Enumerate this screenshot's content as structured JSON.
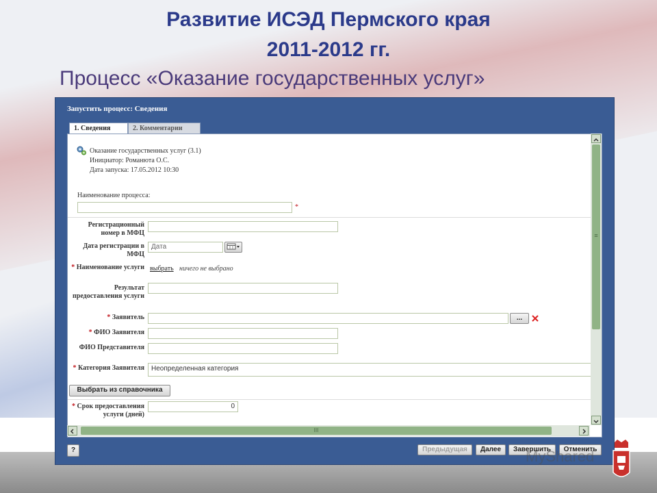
{
  "slide": {
    "title_line1": "Развитие ИСЭД Пермского края",
    "title_line2": "2011-2012 гг.",
    "title_line3": "Процесс «Оказание государственных услуг»"
  },
  "window": {
    "title": "Запустить процесс: Сведения",
    "tabs": [
      {
        "label": "1. Сведения",
        "active": true
      },
      {
        "label": "2. Комментарии",
        "active": false
      }
    ]
  },
  "process_info": {
    "name": "Оказание государственных услуг (3.1)",
    "initiator": "Инициатор: Романюта О.С.",
    "start_date": "Дата запуска: 17.05.2012 10:30"
  },
  "form": {
    "process_name_label": "Наименование процесса:",
    "process_name_value": "",
    "required_mark": "*",
    "reg_number_label": "Регистрационный номер в МФЦ",
    "reg_date_label": "Дата регистрации в МФЦ",
    "reg_date_placeholder": "Дата",
    "service_name_label": "Наименование услуги",
    "choose_link": "выбрать",
    "nothing_selected": "ничего не выбрано",
    "result_label": "Результат предоставления услуги",
    "applicant_label": "Заявитель",
    "applicant_btn": "...",
    "applicant_name_label": "ФИО Заявителя",
    "representative_label": "ФИО Представителя",
    "category_label": "Категория Заявителя",
    "category_value": "Неопределенная категория",
    "choose_from_dict": "Выбрать из справочника",
    "term_label": "Срок предоставления услуги (дней)",
    "term_value": "0"
  },
  "footer": {
    "help": "?",
    "prev": "Предыдущая",
    "next": "Далее",
    "finish": "Завершить",
    "cancel": "Отменить"
  },
  "scroll": {
    "h_label": "III",
    "v_label": "≡"
  },
  "watermark": "MyShared",
  "colors": {
    "title": "#2b3a8a",
    "window": "#3a5c94",
    "required": "#c0151b",
    "scroll": "#90b386"
  }
}
